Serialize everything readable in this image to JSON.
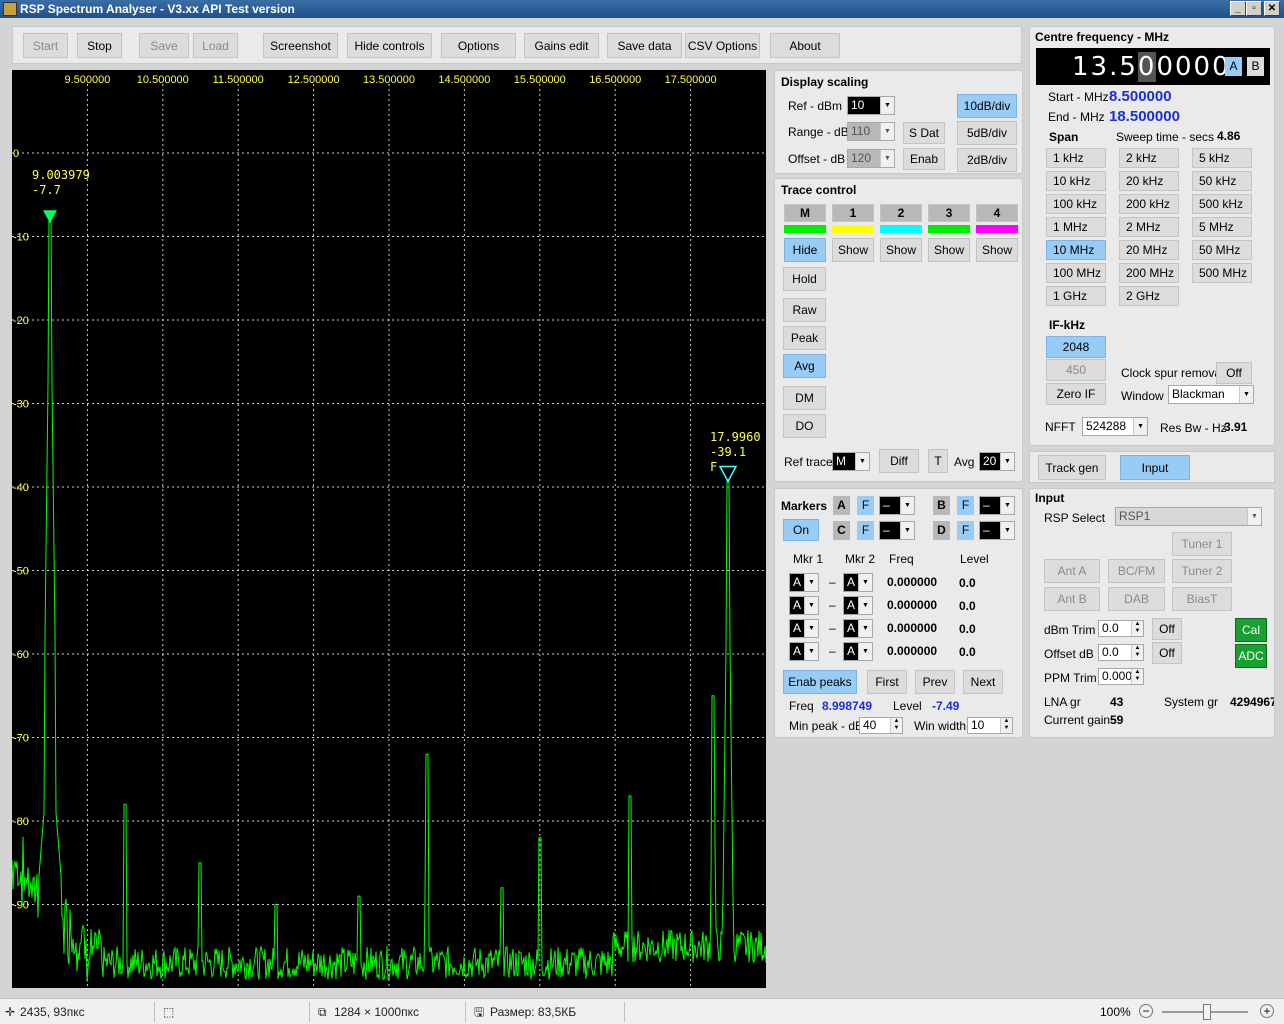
{
  "window": {
    "title": "RSP Spectrum Analyser - V3.xx API Test version"
  },
  "toolbar": {
    "start": "Start",
    "stop": "Stop",
    "save": "Save",
    "load": "Load",
    "screenshot": "Screenshot",
    "hide_controls": "Hide controls",
    "options": "Options",
    "gains_edit": "Gains edit",
    "save_data": "Save data",
    "csv_options": "CSV Options",
    "about": "About"
  },
  "plot": {
    "x_ticks": [
      "9.500000",
      "10.500000",
      "11.500000",
      "12.500000",
      "13.500000",
      "14.500000",
      "15.500000",
      "16.500000",
      "17.500000"
    ],
    "y_ticks": [
      "0",
      "-10",
      "-20",
      "-30",
      "-40",
      "-50",
      "-60",
      "-70",
      "-80",
      "-90"
    ],
    "marker1_freq": "9.003979",
    "marker1_level": "-7.7",
    "marker2_freq": "17.9960",
    "marker2_level": "-39.1",
    "marker2_tag": "F"
  },
  "chart_data": {
    "type": "line",
    "xlim": [
      8.5,
      18.5
    ],
    "ylim": [
      -100,
      0
    ],
    "x_ticks": [
      9.5,
      10.5,
      11.5,
      12.5,
      13.5,
      14.5,
      15.5,
      16.5,
      17.5
    ],
    "y_ticks": [
      0,
      -10,
      -20,
      -30,
      -40,
      -50,
      -60,
      -70,
      -80,
      -90
    ],
    "noise_floor": -97,
    "peaks": [
      {
        "x": 9.004,
        "y": -7.7
      },
      {
        "x": 17.996,
        "y": -39.1
      },
      {
        "x": 10.0,
        "y": -78
      },
      {
        "x": 11.0,
        "y": -85
      },
      {
        "x": 12.0,
        "y": -90
      },
      {
        "x": 13.1,
        "y": -89
      },
      {
        "x": 14.0,
        "y": -72
      },
      {
        "x": 15.0,
        "y": -88
      },
      {
        "x": 15.5,
        "y": -82
      },
      {
        "x": 16.7,
        "y": -77
      },
      {
        "x": 17.8,
        "y": -65
      }
    ],
    "grid": true,
    "color": "#00ff00"
  },
  "display_scaling": {
    "title": "Display scaling",
    "ref_label": "Ref - dBm",
    "ref_value": "10",
    "range_label": "Range - dB",
    "range_value": "110",
    "offset_label": "Offset - dB",
    "offset_value": "120",
    "sdat": "S Dat",
    "enab": "Enab",
    "div10": "10dB/div",
    "div5": "5dB/div",
    "div2": "2dB/div"
  },
  "trace_control": {
    "title": "Trace control",
    "traces": [
      {
        "label": "M",
        "color": "#00ee00",
        "btn": "Hide"
      },
      {
        "label": "1",
        "color": "#ffff00",
        "btn": "Show"
      },
      {
        "label": "2",
        "color": "#00ffff",
        "btn": "Show"
      },
      {
        "label": "3",
        "color": "#00ee00",
        "btn": "Show"
      },
      {
        "label": "4",
        "color": "#ff00ff",
        "btn": "Show"
      }
    ],
    "hold": "Hold",
    "raw": "Raw",
    "peak": "Peak",
    "avg": "Avg",
    "dm": "DM",
    "do": "DO",
    "ref_trace_label": "Ref trace",
    "ref_trace_value": "M",
    "diff": "Diff",
    "t": "T",
    "avg_label": "Avg",
    "avg_value": "20"
  },
  "markers": {
    "title": "Markers",
    "on": "On",
    "a": "A",
    "b": "B",
    "c": "C",
    "d": "D",
    "f": "F",
    "dash": "–",
    "col_mkr1": "Mkr 1",
    "col_mkr2": "Mkr 2",
    "col_freq": "Freq",
    "col_level": "Level",
    "rows": [
      {
        "m1": "A",
        "m2": "A",
        "freq": "0.000000",
        "level": "0.0"
      },
      {
        "m1": "A",
        "m2": "A",
        "freq": "0.000000",
        "level": "0.0"
      },
      {
        "m1": "A",
        "m2": "A",
        "freq": "0.000000",
        "level": "0.0"
      },
      {
        "m1": "A",
        "m2": "A",
        "freq": "0.000000",
        "level": "0.0"
      }
    ],
    "enab_peaks": "Enab peaks",
    "first": "First",
    "prev": "Prev",
    "next": "Next",
    "freq_label": "Freq",
    "freq_value": "8.998749",
    "level_label": "Level",
    "level_value": "-7.49",
    "min_peak_label": "Min peak - dB",
    "min_peak_value": "40",
    "win_width_label": "Win width",
    "win_width_value": "10"
  },
  "centre": {
    "title": "Centre frequency - MHz",
    "digits_a": "13.5",
    "digits_sel": "0",
    "digits_b": "0000",
    "a": "A",
    "b": "B",
    "start_label": "Start - MHz",
    "start_value": "8.500000",
    "end_label": "End - MHz",
    "end_value": "18.500000",
    "span_label": "Span",
    "sweep_label": "Sweep time - secs",
    "sweep_value": "4.86",
    "spans": [
      "1 kHz",
      "2 kHz",
      "5 kHz",
      "10 kHz",
      "20 kHz",
      "50 kHz",
      "100 kHz",
      "200 kHz",
      "500 kHz",
      "1 MHz",
      "2 MHz",
      "5 MHz",
      "10 MHz",
      "20 MHz",
      "50 MHz",
      "100 MHz",
      "200 MHz",
      "500 MHz",
      "1 GHz",
      "2 GHz"
    ],
    "if_label": "IF-kHz",
    "if_2048": "2048",
    "if_450": "450",
    "zero_if": "Zero IF",
    "clock_spur_label": "Clock spur removal",
    "clock_spur_value": "Off",
    "window_label": "Window",
    "window_value": "Blackman",
    "nfft_label": "NFFT",
    "nfft_value": "524288",
    "resbw_label": "Res Bw - Hz",
    "resbw_value": "3.91"
  },
  "tabs": {
    "track_gen": "Track gen",
    "input": "Input"
  },
  "input": {
    "title": "Input",
    "rsp_select_label": "RSP Select",
    "rsp_select_value": "RSP1",
    "tuner1": "Tuner 1",
    "tuner2": "Tuner 2",
    "ant_a": "Ant A",
    "ant_b": "Ant B",
    "bcfm": "BC/FM",
    "dab": "DAB",
    "biast": "BiasT",
    "dbm_trim_label": "dBm Trim",
    "dbm_trim_value": "0.0",
    "off1": "Off",
    "offset_label": "Offset dB",
    "offset_value": "0.0",
    "off2": "Off",
    "ppm_label": "PPM Trim",
    "ppm_value": "0.000",
    "cal": "Cal",
    "adc": "ADC",
    "lna_label": "LNA gr",
    "lna_value": "43",
    "system_label": "System gr",
    "system_value": "4294967",
    "current_label": "Current gain",
    "current_value": "59"
  },
  "status": {
    "coords": "2435, 93пкс",
    "dims": "1284 × 1000пкс",
    "size": "Размер: 83,5КБ",
    "zoom": "100%"
  }
}
